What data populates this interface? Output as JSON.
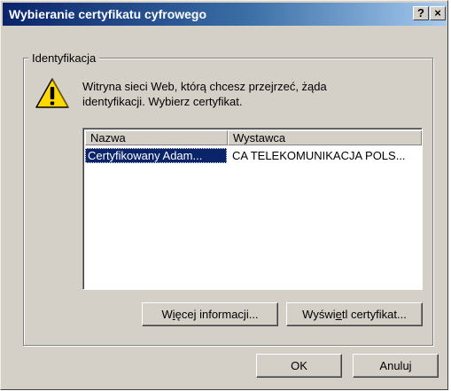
{
  "window": {
    "title": "Wybieranie certyfikatu cyfrowego",
    "help_label": "?",
    "close_label": "×"
  },
  "group": {
    "label": "Identyfikacja"
  },
  "message": {
    "line1": "Witryna sieci Web, którą chcesz przejrzeć, żąda",
    "line2": "identyfikacji. Wybierz certyfikat."
  },
  "table": {
    "columns": [
      "Nazwa",
      "Wystawca"
    ],
    "rows": [
      {
        "name": "Certyfikowany Adam...",
        "issuer": "CA TELEKOMUNIKACJA POLS...",
        "selected": true
      }
    ]
  },
  "buttons": {
    "more_info": {
      "before": "W",
      "accel": "i",
      "after": "ęcej informacji..."
    },
    "view_cert": {
      "before": "Wyświ",
      "accel": "e",
      "after": "tl certyfikat..."
    },
    "ok": "OK",
    "cancel": "Anuluj"
  },
  "icons": {
    "warning": "warning-triangle-icon",
    "help": "help-icon",
    "close": "close-icon"
  },
  "colors": {
    "dialog_face": "#d4d0c8",
    "title_start": "#0a246a",
    "title_end": "#a6caf0",
    "selection": "#0a246a",
    "warning_fill": "#ffd800"
  }
}
